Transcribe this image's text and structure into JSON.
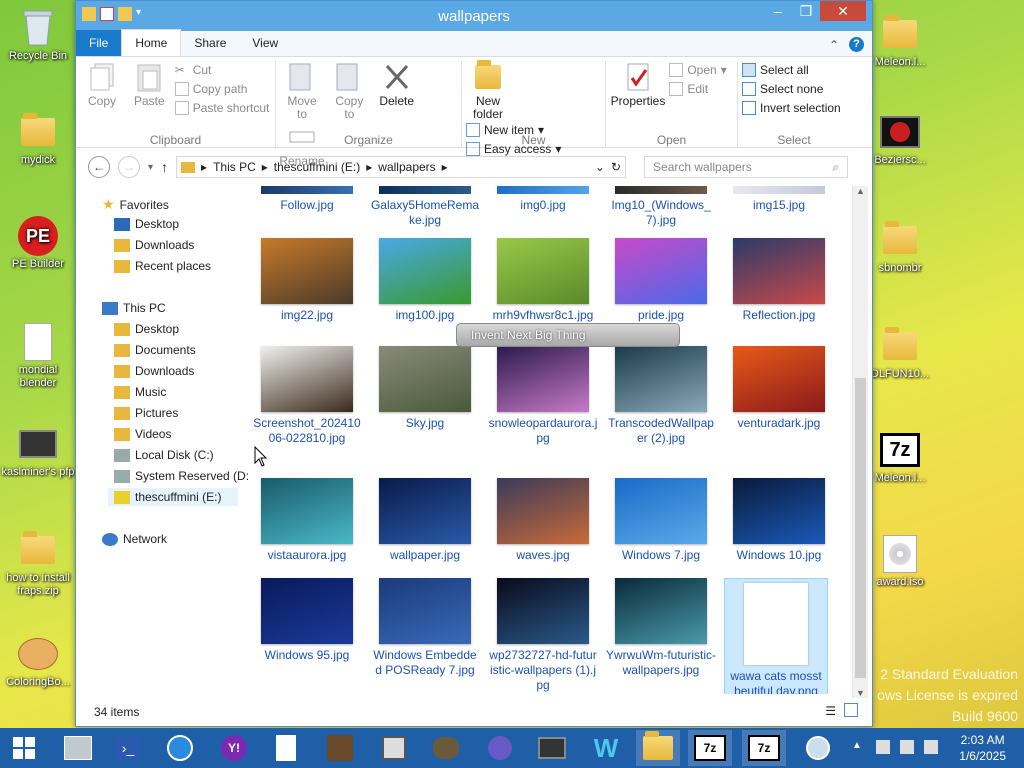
{
  "desktop": {
    "left_icons": [
      {
        "label": "Recycle Bin"
      },
      {
        "label": "mydick"
      },
      {
        "label": "PE Builder"
      },
      {
        "label": "mondial blender"
      },
      {
        "label": "kaslminer's pfp"
      },
      {
        "label": "how to install fraps.zip"
      },
      {
        "label": "ColoringBo..."
      }
    ],
    "right_icons": [
      {
        "label": "Meleon.l..."
      },
      {
        "label": "Beziersc..."
      },
      {
        "label": "sbnombr"
      },
      {
        "label": "DLFUN10..."
      },
      {
        "label": "Meleon.l..."
      },
      {
        "label": "award.iso"
      }
    ],
    "watermark": [
      "2 Standard Evaluation",
      "ows License is expired",
      "Build 9600"
    ]
  },
  "window": {
    "title": "wallpapers",
    "tabs": [
      {
        "label": "File"
      },
      {
        "label": "Home"
      },
      {
        "label": "Share"
      },
      {
        "label": "View"
      }
    ],
    "ribbon": {
      "clipboard": {
        "label": "Clipboard",
        "copy": "Copy",
        "paste": "Paste",
        "cut": "Cut",
        "copy_path": "Copy path",
        "paste_shortcut": "Paste shortcut"
      },
      "organize": {
        "label": "Organize",
        "move_to": "Move to",
        "copy_to": "Copy to",
        "delete": "Delete",
        "rename": "Rename"
      },
      "new": {
        "label": "New",
        "new_folder": "New folder",
        "new_item": "New item",
        "easy_access": "Easy access"
      },
      "open": {
        "label": "Open",
        "properties": "Properties",
        "open": "Open",
        "edit": "Edit"
      },
      "select": {
        "label": "Select",
        "select_all": "Select all",
        "select_none": "Select none",
        "invert": "Invert selection"
      }
    },
    "address": {
      "crumbs": [
        "This PC",
        "thescuffmini (E:)",
        "wallpapers"
      ],
      "search_placeholder": "Search wallpapers"
    },
    "nav": {
      "favorites": "Favorites",
      "fav_items": [
        "Desktop",
        "Downloads",
        "Recent places"
      ],
      "this_pc": "This PC",
      "pc_items": [
        "Desktop",
        "Documents",
        "Downloads",
        "Music",
        "Pictures",
        "Videos",
        "Local Disk (C:)",
        "System Reserved (D:",
        "thescuffmini (E:)"
      ],
      "network": "Network"
    },
    "files": [
      {
        "name": "Follow.jpg",
        "colors": [
          "#1b3a6b",
          "#3a6fb0"
        ]
      },
      {
        "name": "Galaxy5HomeRemake.jpg",
        "colors": [
          "#0d2f5a",
          "#2a5c8a"
        ]
      },
      {
        "name": "img0.jpg",
        "colors": [
          "#1e6fc0",
          "#52a4e8"
        ]
      },
      {
        "name": "Img10_(Windows_7).jpg",
        "colors": [
          "#2b2b2b",
          "#6b5b4b"
        ]
      },
      {
        "name": "img15.jpg",
        "colors": [
          "#e8e8f0",
          "#c4c8d8"
        ]
      },
      {
        "name": "img22.jpg",
        "colors": [
          "#c87a2a",
          "#4a3a2a"
        ]
      },
      {
        "name": "img100.jpg",
        "colors": [
          "#4aa8e8",
          "#3a9a2a"
        ]
      },
      {
        "name": "mrh9vfhwsr8c1.jpg",
        "colors": [
          "#9ac84a",
          "#5a8a2a"
        ]
      },
      {
        "name": "pride.jpg",
        "colors": [
          "#c84ac8",
          "#4a6ae8"
        ]
      },
      {
        "name": "Reflection.jpg",
        "colors": [
          "#2a3a6a",
          "#c84a4a"
        ]
      },
      {
        "name": "Screenshot_20241006-022810.jpg",
        "colors": [
          "#f0f0f0",
          "#3a2a1a"
        ]
      },
      {
        "name": "Sky.jpg",
        "colors": [
          "#8a8a7a",
          "#4a5a3a"
        ]
      },
      {
        "name": "snowleopardaurora.jpg",
        "colors": [
          "#2a1a4a",
          "#c87ac8"
        ]
      },
      {
        "name": "TranscodedWallpaper (2).jpg",
        "colors": [
          "#1a3a4a",
          "#8aaaba"
        ]
      },
      {
        "name": "venturadark.jpg",
        "colors": [
          "#e85a1a",
          "#8a1a1a"
        ]
      },
      {
        "name": "vistaaurora.jpg",
        "colors": [
          "#1a5a6a",
          "#4ab8c8"
        ]
      },
      {
        "name": "wallpaper.jpg",
        "colors": [
          "#0a1a4a",
          "#2a5aa8"
        ]
      },
      {
        "name": "waves.jpg",
        "colors": [
          "#3a3a5a",
          "#c86a3a"
        ]
      },
      {
        "name": "Windows 7.jpg",
        "colors": [
          "#1a6ac8",
          "#5aaae8"
        ]
      },
      {
        "name": "Windows 10.jpg",
        "colors": [
          "#0a1a3a",
          "#1a5ab8"
        ]
      },
      {
        "name": "Windows 95.jpg",
        "colors": [
          "#0a1a5a",
          "#1a3a9a"
        ]
      },
      {
        "name": "Windows Embedded POSReady 7.jpg",
        "colors": [
          "#1a3a7a",
          "#3a6ab8"
        ]
      },
      {
        "name": "wp2732727-hd-futuristic-wallpapers (1).jpg",
        "colors": [
          "#0a0a1a",
          "#2a5a8a"
        ]
      },
      {
        "name": "YwrwuWm-futuristic-wallpapers.jpg",
        "colors": [
          "#0a2a3a",
          "#4a9aaa"
        ]
      },
      {
        "name": "wawa cats mosst beutiful day.png",
        "colors": [
          "#ffffff",
          "#e8e8e8"
        ]
      }
    ],
    "tooltip": "Invent Next Big Thing",
    "status": "34 items"
  },
  "taskbar": {
    "time": "2:03 AM",
    "date": "1/6/2025"
  }
}
